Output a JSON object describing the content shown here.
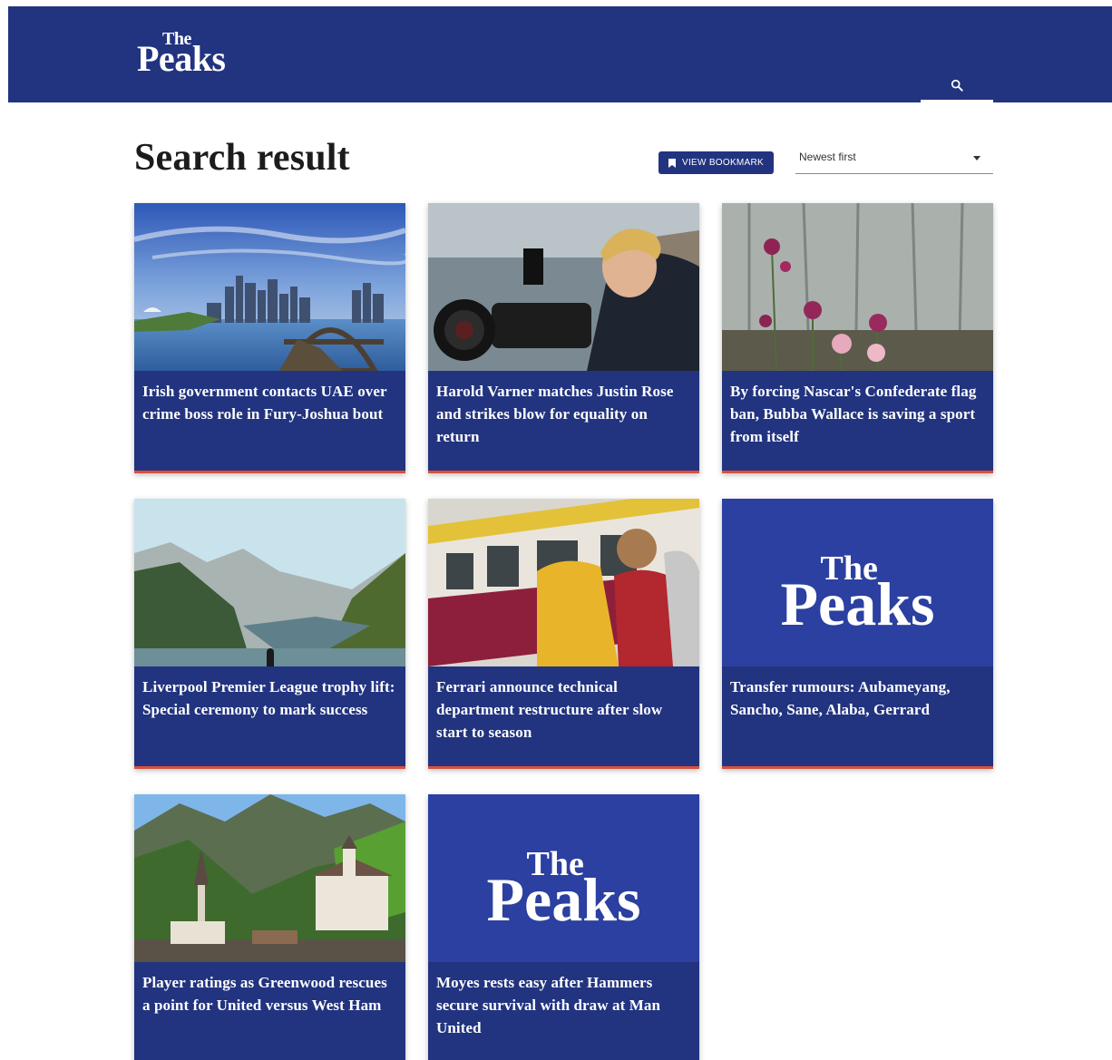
{
  "header": {
    "logo_the": "The",
    "logo_peaks": "Peaks",
    "search_icon": "search-icon"
  },
  "main": {
    "title": "Search result",
    "bookmark_label": "VIEW BOOKMARK",
    "bookmark_icon": "bookmark-icon",
    "sort": {
      "selected": "Newest first"
    }
  },
  "colors": {
    "brand_blue": "#22347f",
    "logo_card_blue": "#2b40a0",
    "accent_red": "#d9503c"
  },
  "cards": [
    {
      "title": "Irish government contacts UAE over crime boss role in Fury-Joshua bout",
      "image": "city-harbour-photo"
    },
    {
      "title": "Harold Varner matches Justin Rose and strikes blow for equality on return",
      "image": "cameraman-photo"
    },
    {
      "title": "By forcing Nascar's Confederate flag ban, Bubba Wallace is saving a sport from itself",
      "image": "flowers-forest-photo"
    },
    {
      "title": "Liverpool Premier League trophy lift: Special ceremony to mark success",
      "image": "mountain-lake-photo"
    },
    {
      "title": "Ferrari announce technical department restructure after slow start to season",
      "image": "train-backpacker-photo"
    },
    {
      "title": "Transfer rumours: Aubameyang, Sancho, Sane, Alaba, Gerrard",
      "image": "the-peaks-logo",
      "logo_the": "The",
      "logo_peaks": "Peaks"
    },
    {
      "title": "Player ratings as Greenwood rescues a point for United versus West Ham",
      "image": "alpine-village-photo"
    },
    {
      "title": "Moyes rests easy after Hammers secure survival with draw at Man United",
      "image": "the-peaks-logo",
      "logo_the": "The",
      "logo_peaks": "Peaks"
    }
  ]
}
